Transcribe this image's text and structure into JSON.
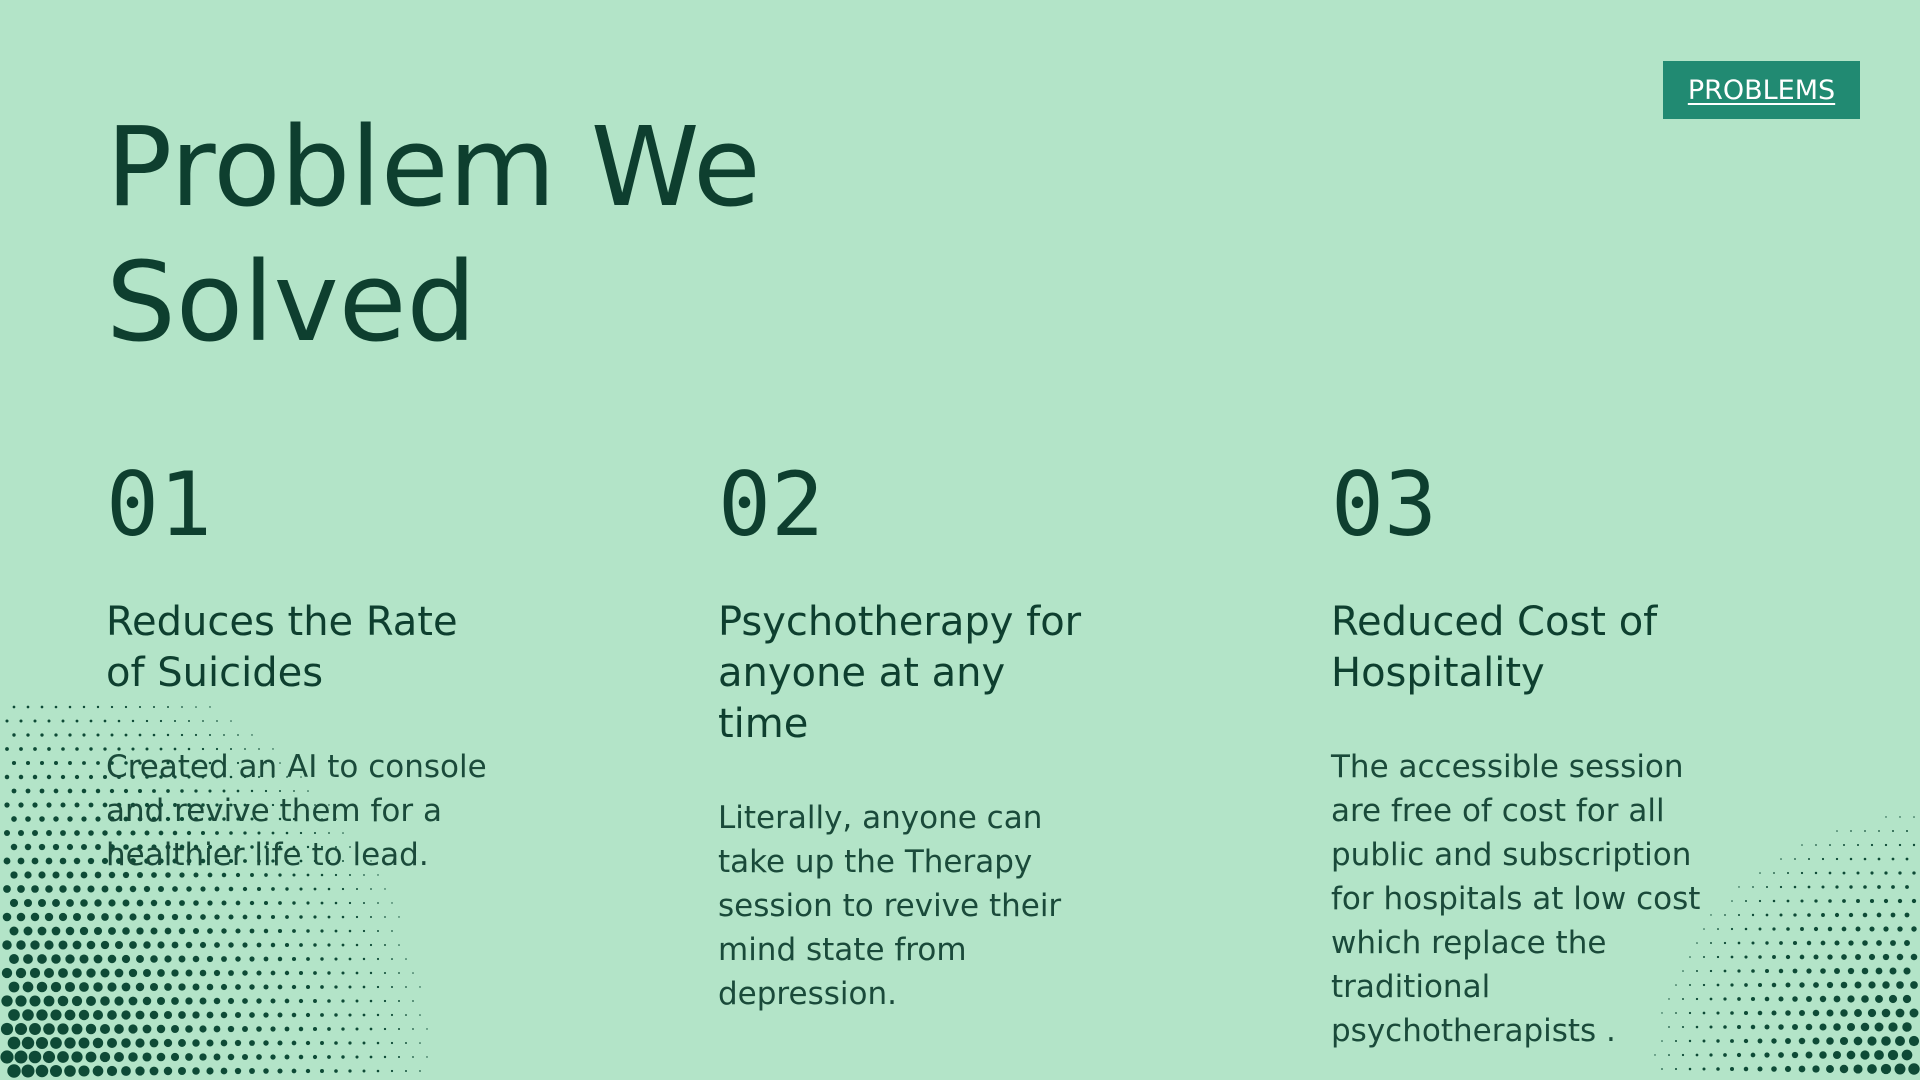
{
  "badge": {
    "label": "PROBLEMS"
  },
  "title": {
    "line1": "Problem We",
    "line2": "Solved"
  },
  "items": [
    {
      "number": "01",
      "heading_lines": [
        "Reduces the Rate",
        "of Suicides"
      ],
      "desc_lines": [
        "Created an AI to console",
        "and revive them for a",
        "healthier life to lead."
      ]
    },
    {
      "number": "02",
      "heading_lines": [
        "Psychotherapy for",
        "anyone at any",
        "time"
      ],
      "desc_lines": [
        "Literally, anyone can",
        "take up the Therapy",
        "session to revive their",
        "mind state from",
        "depression."
      ]
    },
    {
      "number": "03",
      "heading_lines": [
        "Reduced Cost of",
        "Hospitality"
      ],
      "desc_lines": [
        "The accessible session",
        "are free of cost for all",
        "public and subscription",
        "for hospitals at low cost",
        "which replace the",
        "traditional",
        "psychotherapists ."
      ]
    }
  ],
  "colors": {
    "background": "#b3e4c8",
    "text_dark": "#0e3f2f",
    "badge_bg": "#218a72",
    "badge_text": "#ffffff",
    "dots": "#0e4a36"
  }
}
